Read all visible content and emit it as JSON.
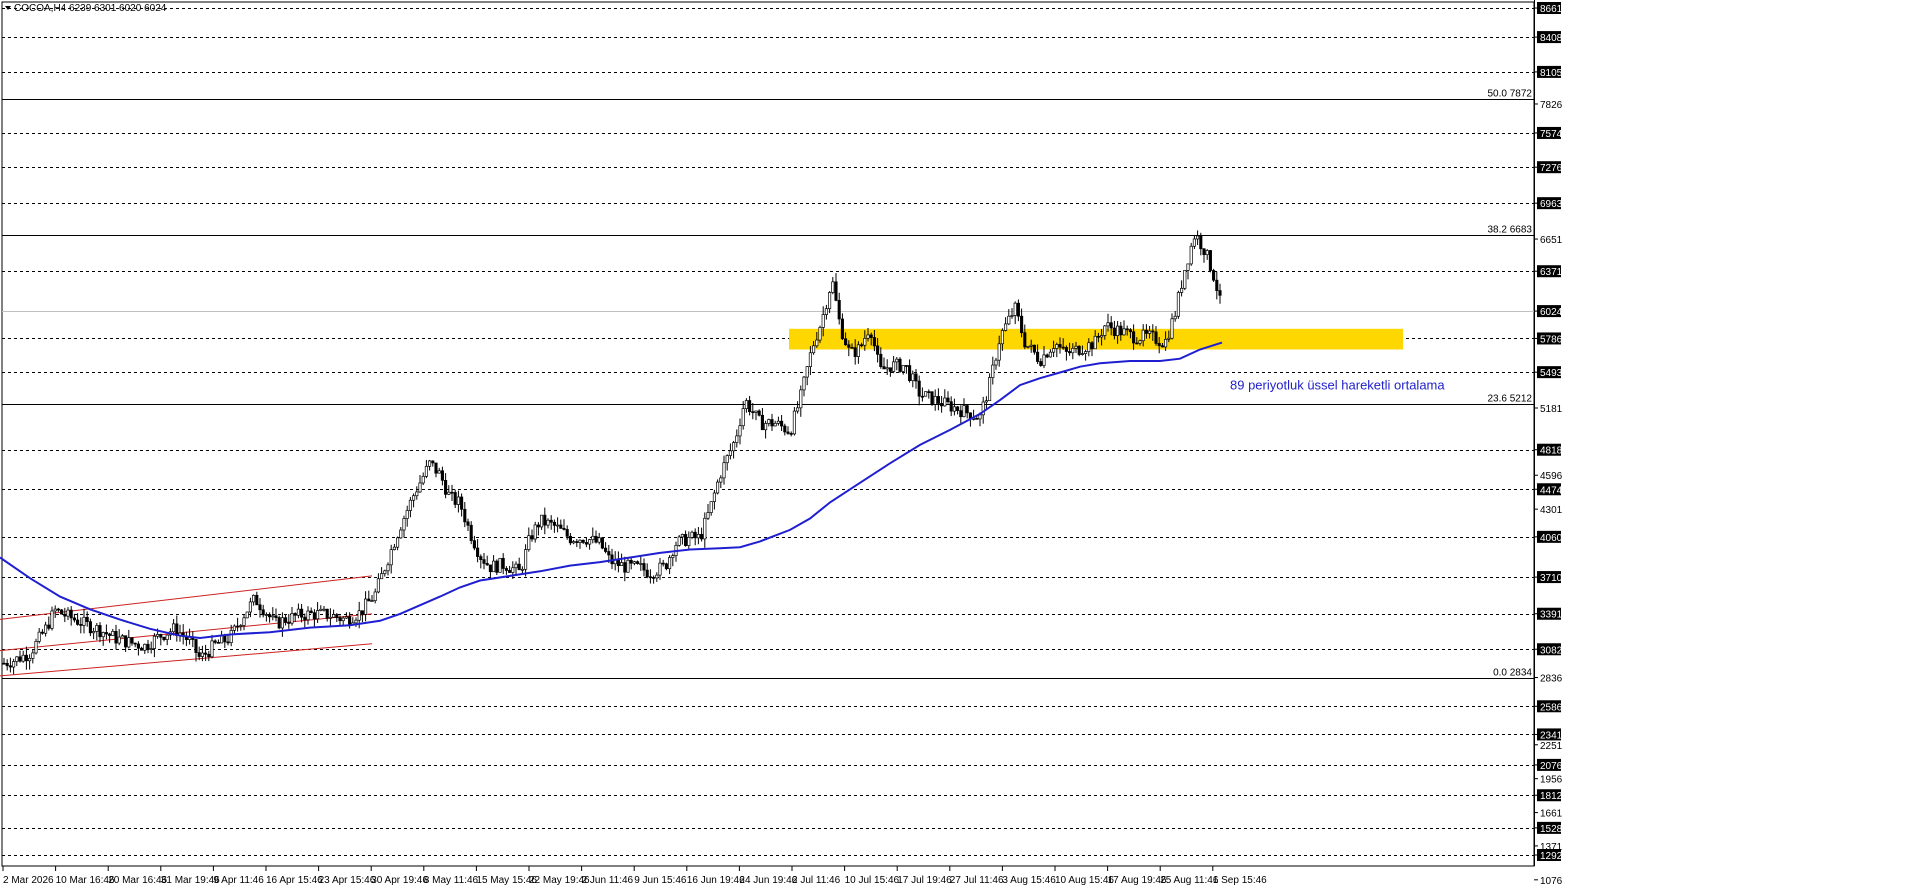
{
  "chart_data": {
    "type": "candlestick",
    "symbol": "COCOA,H4",
    "ohlc_header": "COCOA,H4  6239 6301 6020 6024",
    "ylim": [
      1076,
      8661
    ],
    "y_ticks": [
      8661,
      8408,
      8105,
      7826,
      7574,
      7276,
      6963,
      6651,
      6371,
      6024,
      5786,
      5493,
      5181,
      4818,
      4596,
      4474,
      4301,
      4060,
      3710,
      3391,
      3082,
      2836,
      2586,
      2341,
      2251,
      2076,
      1956,
      1812,
      1661,
      1528,
      1371,
      1292,
      1076
    ],
    "y_boxed_ticks": [
      8661,
      8408,
      8105,
      7574,
      7276,
      6963,
      6371,
      6024,
      5786,
      5493,
      4818,
      4474,
      4060,
      3710,
      3391,
      3082,
      2586,
      2341,
      2076,
      1812,
      1528,
      1292
    ],
    "x_labels": [
      "2 Mar 2026",
      "10 Mar 16:46",
      "20 Mar 16:46",
      "31 Mar 19:46",
      "9 Apr 11:46",
      "16 Apr 15:46",
      "23 Apr 15:46",
      "30 Apr 19:46",
      "8 May 11:46",
      "15 May 15:46",
      "22 May 19:46",
      "2 Jun 11:46",
      "9 Jun 15:46",
      "16 Jun 19:46",
      "24 Jun 19:46",
      "2 Jul 11:46",
      "10 Jul 15:46",
      "17 Jul 19:46",
      "27 Jul 11:46",
      "3 Aug 15:46",
      "10 Aug 15:46",
      "17 Aug 19:46",
      "25 Aug 11:46",
      "1 Sep 15:46"
    ],
    "fibonacci": [
      {
        "label": "50.0 7872",
        "value": 7872
      },
      {
        "label": "38.2 6683",
        "value": 6683
      },
      {
        "label": "23.6 5212",
        "value": 5212
      },
      {
        "label": "0.0 2834",
        "value": 2834
      }
    ],
    "grid_levels": [
      8661,
      8408,
      8105,
      7574,
      7276,
      6963,
      6371,
      5786,
      5493,
      4818,
      4474,
      4060,
      3710,
      3391,
      3082,
      2586,
      2341,
      2076,
      1812,
      1528,
      1292
    ],
    "last_price": 6024,
    "support_zone": {
      "low": 5690,
      "high": 5870,
      "color": "#ffd700"
    },
    "ema": {
      "period": 89,
      "color": "#1f1fd1",
      "points": [
        [
          0,
          3880
        ],
        [
          30,
          3700
        ],
        [
          60,
          3540
        ],
        [
          90,
          3430
        ],
        [
          120,
          3340
        ],
        [
          150,
          3260
        ],
        [
          180,
          3200
        ],
        [
          200,
          3180
        ],
        [
          230,
          3210
        ],
        [
          270,
          3230
        ],
        [
          310,
          3270
        ],
        [
          350,
          3290
        ],
        [
          380,
          3330
        ],
        [
          400,
          3390
        ],
        [
          440,
          3540
        ],
        [
          460,
          3620
        ],
        [
          480,
          3680
        ],
        [
          510,
          3720
        ],
        [
          540,
          3760
        ],
        [
          570,
          3810
        ],
        [
          600,
          3840
        ],
        [
          630,
          3880
        ],
        [
          660,
          3920
        ],
        [
          690,
          3950
        ],
        [
          720,
          3960
        ],
        [
          740,
          3970
        ],
        [
          760,
          4020
        ],
        [
          790,
          4120
        ],
        [
          810,
          4220
        ],
        [
          830,
          4360
        ],
        [
          860,
          4530
        ],
        [
          890,
          4700
        ],
        [
          920,
          4860
        ],
        [
          950,
          4990
        ],
        [
          980,
          5130
        ],
        [
          1000,
          5250
        ],
        [
          1020,
          5380
        ],
        [
          1040,
          5440
        ],
        [
          1060,
          5490
        ],
        [
          1080,
          5540
        ],
        [
          1100,
          5570
        ],
        [
          1130,
          5590
        ],
        [
          1160,
          5590
        ],
        [
          1180,
          5610
        ],
        [
          1200,
          5690
        ],
        [
          1222,
          5750
        ]
      ]
    },
    "channel_lines": [
      {
        "from": [
          0,
          3342
        ],
        "to": [
          372,
          3720
        ]
      },
      {
        "from": [
          0,
          3070
        ],
        "to": [
          372,
          3390
        ]
      },
      {
        "from": [
          0,
          2850
        ],
        "to": [
          372,
          3130
        ]
      }
    ],
    "candles_path": [
      [
        0,
        2950
      ],
      [
        15,
        2990
      ],
      [
        30,
        3050
      ],
      [
        45,
        3250
      ],
      [
        55,
        3420
      ],
      [
        70,
        3360
      ],
      [
        85,
        3300
      ],
      [
        100,
        3250
      ],
      [
        115,
        3180
      ],
      [
        130,
        3140
      ],
      [
        145,
        3110
      ],
      [
        160,
        3200
      ],
      [
        175,
        3260
      ],
      [
        190,
        3150
      ],
      [
        200,
        3000
      ],
      [
        215,
        3120
      ],
      [
        230,
        3180
      ],
      [
        245,
        3400
      ],
      [
        255,
        3520
      ],
      [
        265,
        3420
      ],
      [
        275,
        3300
      ],
      [
        285,
        3340
      ],
      [
        300,
        3380
      ],
      [
        315,
        3390
      ],
      [
        330,
        3380
      ],
      [
        345,
        3340
      ],
      [
        360,
        3400
      ],
      [
        375,
        3560
      ],
      [
        385,
        3800
      ],
      [
        400,
        4150
      ],
      [
        415,
        4450
      ],
      [
        430,
        4700
      ],
      [
        440,
        4600
      ],
      [
        450,
        4400
      ],
      [
        460,
        4350
      ],
      [
        470,
        4100
      ],
      [
        480,
        3900
      ],
      [
        490,
        3800
      ],
      [
        505,
        3820
      ],
      [
        520,
        3750
      ],
      [
        530,
        4050
      ],
      [
        540,
        4200
      ],
      [
        555,
        4150
      ],
      [
        570,
        4050
      ],
      [
        585,
        4050
      ],
      [
        600,
        4000
      ],
      [
        610,
        3850
      ],
      [
        625,
        3800
      ],
      [
        640,
        3790
      ],
      [
        650,
        3750
      ],
      [
        665,
        3800
      ],
      [
        675,
        4000
      ],
      [
        690,
        4050
      ],
      [
        700,
        4050
      ],
      [
        710,
        4300
      ],
      [
        720,
        4600
      ],
      [
        735,
        4900
      ],
      [
        745,
        5250
      ],
      [
        760,
        5050
      ],
      [
        775,
        5050
      ],
      [
        790,
        4980
      ],
      [
        800,
        5250
      ],
      [
        812,
        5700
      ],
      [
        822,
        5950
      ],
      [
        832,
        6300
      ],
      [
        840,
        5900
      ],
      [
        850,
        5650
      ],
      [
        860,
        5700
      ],
      [
        870,
        5900
      ],
      [
        880,
        5500
      ],
      [
        890,
        5550
      ],
      [
        905,
        5550
      ],
      [
        920,
        5300
      ],
      [
        935,
        5250
      ],
      [
        950,
        5200
      ],
      [
        965,
        5150
      ],
      [
        980,
        5100
      ],
      [
        990,
        5400
      ],
      [
        1000,
        5800
      ],
      [
        1015,
        6050
      ],
      [
        1025,
        5750
      ],
      [
        1040,
        5600
      ],
      [
        1055,
        5750
      ],
      [
        1065,
        5650
      ],
      [
        1080,
        5700
      ],
      [
        1095,
        5750
      ],
      [
        1105,
        5900
      ],
      [
        1120,
        5850
      ],
      [
        1135,
        5800
      ],
      [
        1150,
        5800
      ],
      [
        1165,
        5750
      ],
      [
        1175,
        6000
      ],
      [
        1185,
        6400
      ],
      [
        1195,
        6700
      ],
      [
        1205,
        6550
      ],
      [
        1215,
        6300
      ],
      [
        1222,
        6024
      ]
    ]
  },
  "annotation": {
    "text": "89 periyotluk üssel hareketli ortalama",
    "x": 1230,
    "price": 5340
  }
}
